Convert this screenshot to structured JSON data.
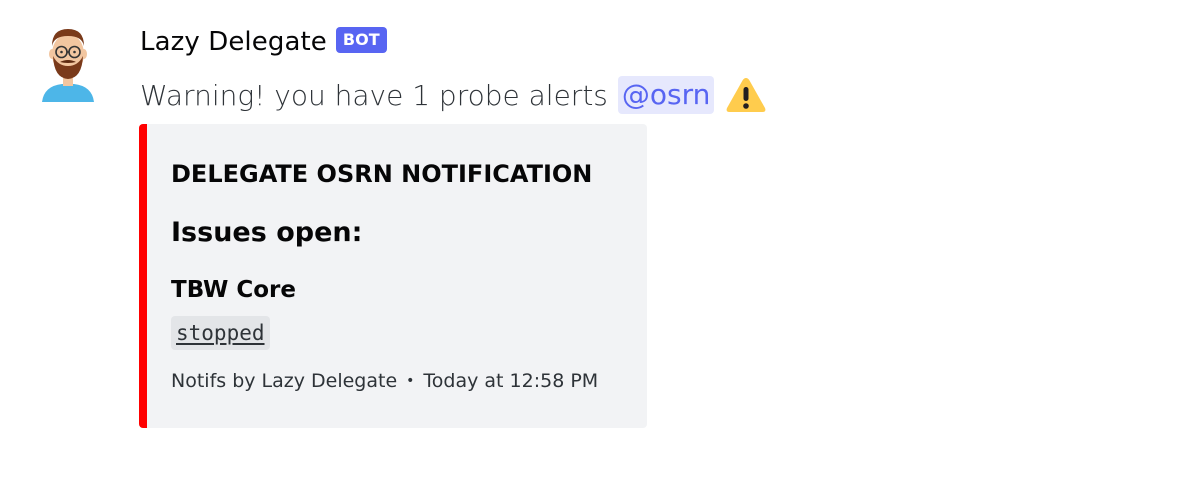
{
  "message": {
    "author": {
      "username": "Lazy Delegate",
      "bot_tag": "BOT",
      "avatar_icon": "bearded-man-avatar"
    },
    "content": {
      "text": "Warning! you have 1 probe alerts",
      "mention": "@osrn",
      "emoji": "warning-icon"
    },
    "embed": {
      "color": "#ff0000",
      "title": "DELEGATE OSRN NOTIFICATION",
      "subtitle": "Issues open:",
      "field": {
        "name": "TBW Core",
        "value": "stopped"
      },
      "footer": {
        "text": "Notifs by Lazy Delegate",
        "separator": "•",
        "timestamp": "Today at 12:58 PM"
      }
    }
  },
  "colors": {
    "bot_tag": "#5865f2",
    "mention_text": "#5865f2",
    "embed_background": "#f2f3f5",
    "embed_bar": "#ff0000"
  }
}
